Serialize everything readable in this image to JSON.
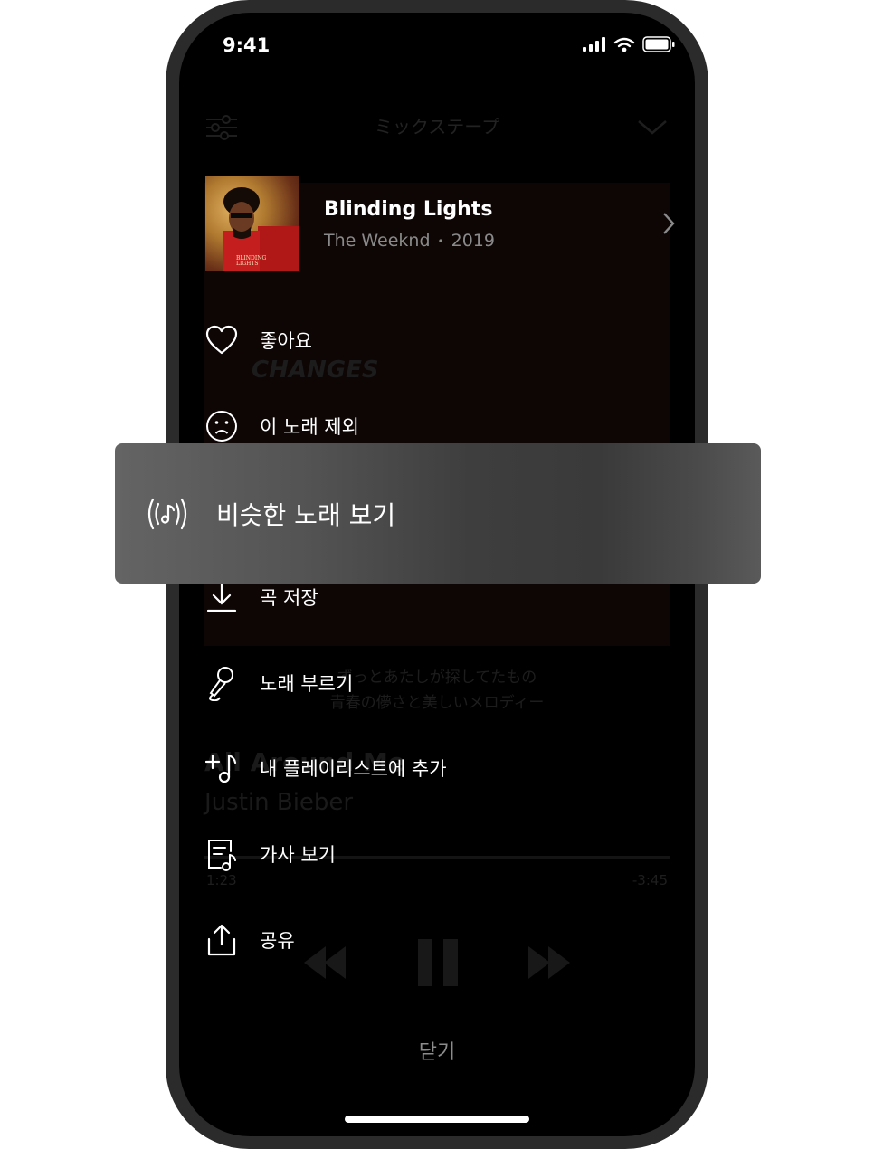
{
  "status_bar": {
    "time": "9:41"
  },
  "background_player": {
    "title": "ミックステープ",
    "art_text": "CHANGES",
    "lyric_line1": "ずっとあたしが探してたもの",
    "lyric_line2": "青春の儚さと美しいメロディー",
    "song": "All Around Me",
    "artist": "Justin Bieber",
    "elapsed": "1:23",
    "remaining": "-3:45"
  },
  "song": {
    "title": "Blinding Lights",
    "artist": "The Weeknd",
    "year": "2019",
    "cover_text": "BLINDING LIGHTS"
  },
  "menu": {
    "like": "좋아요",
    "exclude": "이 노래 제외",
    "similar": "비슷한 노래 보기",
    "save": "곡 저장",
    "sing": "노래 부르기",
    "add_playlist": "내 플레이리스트에 추가",
    "lyrics": "가사 보기",
    "share": "공유"
  },
  "close_label": "닫기",
  "icons": [
    "heart-icon",
    "sad-face-icon",
    "similar-music-icon",
    "download-icon",
    "microphone-icon",
    "add-music-icon",
    "lyrics-icon",
    "share-icon",
    "chevron-right-icon"
  ]
}
